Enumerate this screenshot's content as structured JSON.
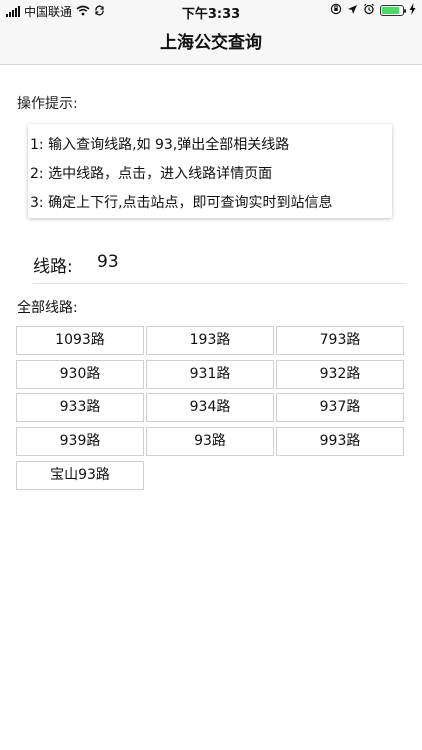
{
  "status_bar": {
    "carrier": "中国联通",
    "time": "下午3:33",
    "battery_level": 0.85,
    "icons": [
      "signal-icon",
      "wifi-icon",
      "sync-icon",
      "rotation-lock-icon",
      "location-icon",
      "alarm-icon",
      "battery-icon",
      "charging-icon"
    ]
  },
  "nav": {
    "title": "上海公交查询"
  },
  "tips": {
    "heading": "操作提示:",
    "items": [
      "1: 输入查询线路,如 93,弹出全部相关线路",
      "2: 选中线路，点击，进入线路详情页面",
      "3: 确定上下行,点击站点，即可查询实时到站信息"
    ]
  },
  "search": {
    "label": "线路:",
    "value": "93"
  },
  "results": {
    "heading": "全部线路:",
    "routes": [
      "1093路",
      "193路",
      "793路",
      "930路",
      "931路",
      "932路",
      "933路",
      "934路",
      "937路",
      "939路",
      "93路",
      "993路",
      "宝山93路"
    ]
  },
  "colors": {
    "battery": "#4cd964",
    "nav_background": "#f7f7f7",
    "button_border": "#cfcfcf"
  }
}
